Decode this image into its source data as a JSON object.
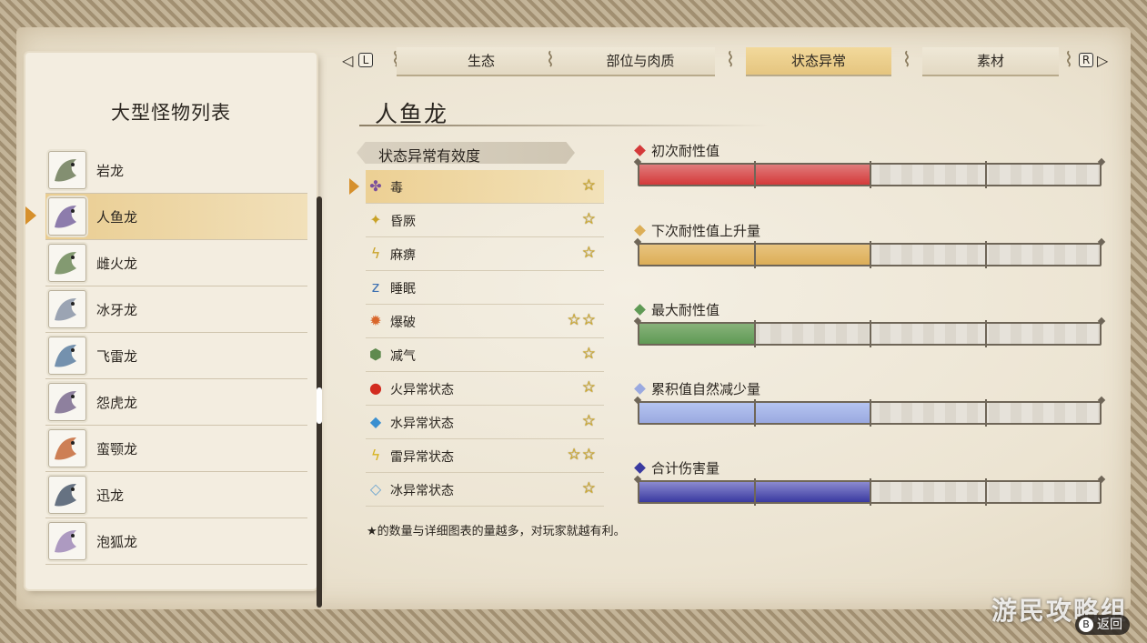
{
  "list_panel": {
    "title": "大型怪物列表",
    "monsters": [
      {
        "name": "岩龙",
        "color": "#6e7d5a"
      },
      {
        "name": "人鱼龙",
        "color": "#7a66a0"
      },
      {
        "name": "雌火龙",
        "color": "#6f8a5a"
      },
      {
        "name": "冰牙龙",
        "color": "#8b95a8"
      },
      {
        "name": "飞雷龙",
        "color": "#5d7fa2"
      },
      {
        "name": "怨虎龙",
        "color": "#7b6b8f"
      },
      {
        "name": "蛮颚龙",
        "color": "#c56a3a"
      },
      {
        "name": "迅龙",
        "color": "#4c5a6e"
      },
      {
        "name": "泡狐龙",
        "color": "#a08ab8"
      }
    ]
  },
  "tabs": {
    "left_button": "L",
    "right_button": "R",
    "items": [
      "生态",
      "部位与肉质",
      "状态异常",
      "素材"
    ],
    "active": "状态异常"
  },
  "monster_name": "人鱼龙",
  "effectiveness": {
    "header": "状态异常有效度",
    "items": [
      {
        "name": "毒",
        "stars": "☆",
        "icon": "poison-icon",
        "glyph": "✤",
        "color": "#7a4f9c"
      },
      {
        "name": "昏厥",
        "stars": "☆",
        "icon": "stun-icon",
        "glyph": "✦",
        "color": "#c9a227"
      },
      {
        "name": "麻痹",
        "stars": "☆",
        "icon": "paralysis-icon",
        "glyph": "ϟ",
        "color": "#c9a227"
      },
      {
        "name": "睡眠",
        "stars": "",
        "icon": "sleep-icon",
        "glyph": "z",
        "color": "#3b6fb0"
      },
      {
        "name": "爆破",
        "stars": "☆☆",
        "icon": "blast-icon",
        "glyph": "✹",
        "color": "#d9662a"
      },
      {
        "name": "减气",
        "stars": "☆",
        "icon": "exhaust-icon",
        "glyph": "⬢",
        "color": "#5f8a4e"
      },
      {
        "name": "火异常状态",
        "stars": "☆",
        "icon": "fireblight-icon",
        "glyph": "●",
        "color": "#d22b1f"
      },
      {
        "name": "水异常状态",
        "stars": "☆",
        "icon": "waterblight-icon",
        "glyph": "◆",
        "color": "#3a8fd0"
      },
      {
        "name": "雷异常状态",
        "stars": "☆☆",
        "icon": "thunderblight-icon",
        "glyph": "ϟ",
        "color": "#d7b21e"
      },
      {
        "name": "冰异常状态",
        "stars": "☆",
        "icon": "iceblight-icon",
        "glyph": "◇",
        "color": "#6aa4d0"
      }
    ],
    "note": "★的数量与详细图表的量越多，对玩家就越有利。"
  },
  "bars": [
    {
      "label": "初次耐性值",
      "color": "#d43a3a",
      "fill": 0.5,
      "fill_color": "#e07b7b"
    },
    {
      "label": "下次耐性值上升量",
      "color": "#dcae57",
      "fill": 0.5,
      "fill_color": "#e8c47f"
    },
    {
      "label": "最大耐性值",
      "color": "#5f9a55",
      "fill": 0.25,
      "fill_color": "#88b27a"
    },
    {
      "label": "累积值自然减少量",
      "color": "#9aa9e0",
      "fill": 0.5,
      "fill_color": "#b5c4f0"
    },
    {
      "label": "合计伤害量",
      "color": "#3a3aa0",
      "fill": 0.5,
      "fill_color": "#8b8ad0"
    }
  ],
  "footer": {
    "watermark": "游民攻略组",
    "back_button": "B",
    "back_label": "返回"
  }
}
